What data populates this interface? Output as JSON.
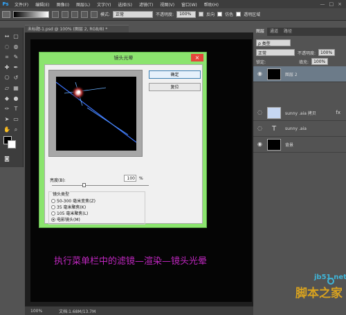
{
  "app": {
    "logo": "Ps",
    "menu_items": [
      "文件(F)",
      "编辑(E)",
      "图像(I)",
      "图层(L)",
      "文字(Y)",
      "选择(S)",
      "滤镜(T)",
      "视图(V)",
      "窗口(W)",
      "帮助(H)"
    ],
    "window_controls": [
      "—",
      "□",
      "×"
    ]
  },
  "options_bar": {
    "mode_label": "模式:",
    "mode_value": "正常",
    "opacity_label": "不透明度:",
    "opacity_value": "100%",
    "reverse_label": "反向",
    "dither_label": "仿色",
    "transparency_label": "透明区域"
  },
  "document": {
    "tab_title": "未标题-1.psd @ 100% (图层 2, RGB/8) *",
    "status_zoom": "100%",
    "status_doc": "文档:1.68M/13.7M"
  },
  "dialog": {
    "title": "镜头光晕",
    "close_label": "×",
    "ok_label": "确定",
    "reset_label": "复位",
    "brightness_label": "亮度(B):",
    "brightness_value": "100",
    "brightness_unit": "%",
    "brightness_level": 0.33,
    "lens_type_label": "镜头类型",
    "lens_options": [
      {
        "label": "50-300 毫米变焦(Z)",
        "selected": false
      },
      {
        "label": "35 毫米聚焦(K)",
        "selected": false
      },
      {
        "label": "105 毫米聚焦(L)",
        "selected": false
      },
      {
        "label": "电影镜头(M)",
        "selected": true
      }
    ]
  },
  "instruction_text": "执行菜单栏中的滤镜—渲染—镜头光晕",
  "layers_panel": {
    "tabs": [
      "图层",
      "通道",
      "路径"
    ],
    "type_label": "ρ 类型",
    "blend_mode": "正常",
    "opacity_label": "不透明度:",
    "opacity_value": "100%",
    "lock_label": "锁定:",
    "fill_label": "填充:",
    "fill_value": "100%",
    "layers": [
      {
        "name": "图层 2",
        "selected": true
      },
      {
        "name": "sunny .aia 拷贝",
        "selected": false,
        "fx": "fx"
      },
      {
        "name": "sunny .aia",
        "selected": false,
        "text_layer": "T"
      },
      {
        "name": "背景",
        "selected": false
      }
    ]
  },
  "watermark": {
    "site": "jb51.net",
    "brand": "脚本之家"
  },
  "colors": {
    "accent": "#31a8ff",
    "dialog_green": "#8be46e",
    "instruction_magenta": "#c027c0",
    "close_red": "#e4463a"
  }
}
